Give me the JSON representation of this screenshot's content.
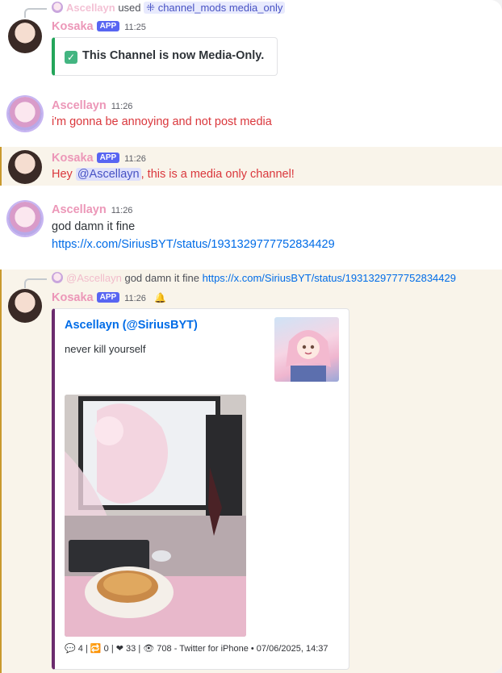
{
  "messages": [
    {
      "reply": {
        "username": "Ascellayn",
        "used_text": "used",
        "command": "channel_mods media_only"
      },
      "author": "Kosaka",
      "badge": "APP",
      "time": "11:25",
      "embed_text": "This Channel is now Media-Only."
    },
    {
      "author": "Ascellayn",
      "time": "11:26",
      "text": "i'm gonna be annoying and not post media"
    },
    {
      "author": "Kosaka",
      "badge": "APP",
      "time": "11:26",
      "text_prefix": "Hey ",
      "mention": "@Ascellayn",
      "text_suffix": ", this is a media only channel!"
    },
    {
      "author": "Ascellayn",
      "time": "11:26",
      "text": "god damn it fine",
      "link": "https://x.com/SiriusBYT/status/1931329777752834429"
    },
    {
      "reply": {
        "username": "@Ascellayn",
        "text": "god damn it fine",
        "link": "https://x.com/SiriusBYT/status/1931329777752834429"
      },
      "author": "Kosaka",
      "badge": "APP",
      "time": "11:26",
      "embed": {
        "author": "Ascellayn (@SiriusBYT)",
        "description": "never kill yourself",
        "footer": {
          "replies": "4",
          "retweets": "0",
          "likes": "33",
          "views": "708",
          "source": "Twitter for iPhone",
          "date": "07/06/2025, 14:37"
        }
      }
    }
  ],
  "colors": {
    "accent": "#5865f2",
    "username": "#ec97b8",
    "error": "#da373c",
    "link": "#006ce7",
    "embed_border": "#6b2c6e",
    "success": "#23a55a"
  }
}
